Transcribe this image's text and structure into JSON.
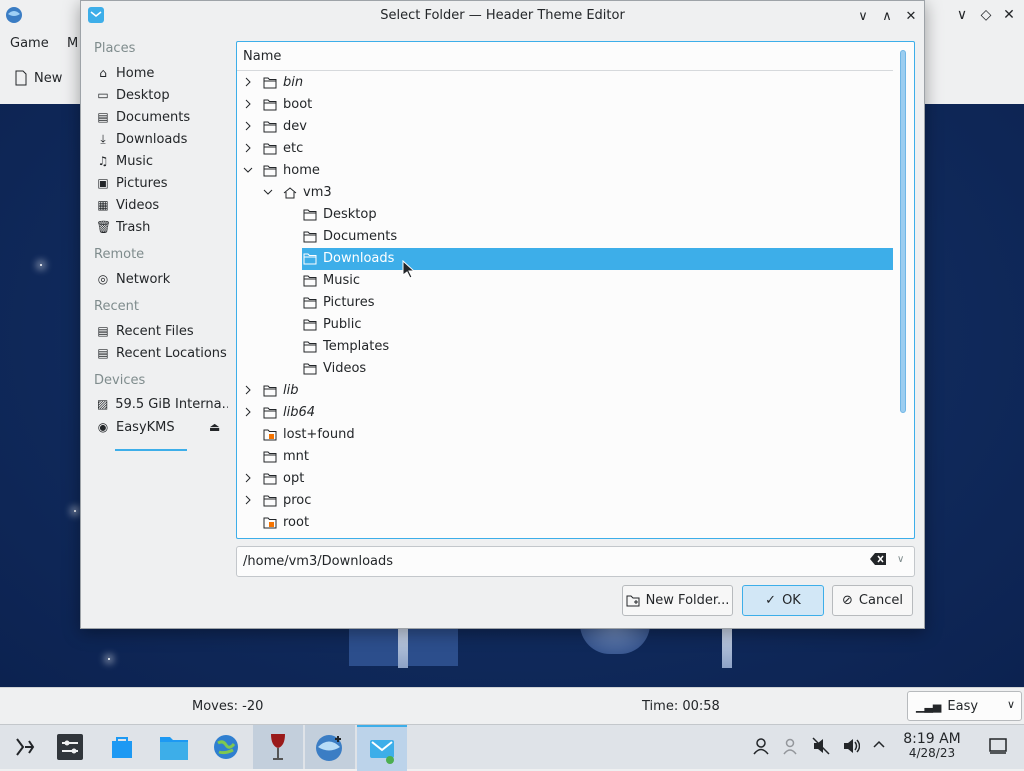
{
  "background_window": {
    "menu": [
      "Game",
      "M"
    ],
    "toolbar_new": "New",
    "status": {
      "moves": "Moves: -20",
      "time": "Time: 00:58",
      "difficulty": "Easy"
    }
  },
  "dialog": {
    "title": "Select Folder — Header Theme Editor",
    "places": {
      "sections": [
        {
          "heading": "Places",
          "items": [
            {
              "label": "Home",
              "icon": "home-icon"
            },
            {
              "label": "Desktop",
              "icon": "desktop-icon"
            },
            {
              "label": "Documents",
              "icon": "documents-icon"
            },
            {
              "label": "Downloads",
              "icon": "downloads-icon"
            },
            {
              "label": "Music",
              "icon": "music-icon"
            },
            {
              "label": "Pictures",
              "icon": "pictures-icon"
            },
            {
              "label": "Videos",
              "icon": "videos-icon"
            },
            {
              "label": "Trash",
              "icon": "trash-icon"
            }
          ]
        },
        {
          "heading": "Remote",
          "items": [
            {
              "label": "Network",
              "icon": "network-icon"
            }
          ]
        },
        {
          "heading": "Recent",
          "items": [
            {
              "label": "Recent Files",
              "icon": "recent-files-icon"
            },
            {
              "label": "Recent Locations",
              "icon": "recent-locations-icon"
            }
          ]
        },
        {
          "heading": "Devices",
          "items": [
            {
              "label": "59.5 GiB Interna…",
              "icon": "drive-icon"
            },
            {
              "label": "EasyKMS",
              "icon": "disc-icon"
            }
          ]
        }
      ]
    },
    "tree": {
      "column_header": "Name",
      "rows": [
        {
          "name": "bin",
          "depth": 0,
          "expander": "collapsed",
          "italic": true
        },
        {
          "name": "boot",
          "depth": 0,
          "expander": "collapsed",
          "italic": false
        },
        {
          "name": "dev",
          "depth": 0,
          "expander": "collapsed",
          "italic": false
        },
        {
          "name": "etc",
          "depth": 0,
          "expander": "collapsed",
          "italic": false
        },
        {
          "name": "home",
          "depth": 0,
          "expander": "expanded",
          "italic": false
        },
        {
          "name": "vm3",
          "depth": 1,
          "expander": "expanded",
          "italic": false,
          "icon": "home"
        },
        {
          "name": "Desktop",
          "depth": 2,
          "expander": "none",
          "italic": false
        },
        {
          "name": "Documents",
          "depth": 2,
          "expander": "none",
          "italic": false
        },
        {
          "name": "Downloads",
          "depth": 2,
          "expander": "none",
          "italic": false,
          "selected": true
        },
        {
          "name": "Music",
          "depth": 2,
          "expander": "none",
          "italic": false
        },
        {
          "name": "Pictures",
          "depth": 2,
          "expander": "none",
          "italic": false
        },
        {
          "name": "Public",
          "depth": 2,
          "expander": "none",
          "italic": false
        },
        {
          "name": "Templates",
          "depth": 2,
          "expander": "none",
          "italic": false
        },
        {
          "name": "Videos",
          "depth": 2,
          "expander": "none",
          "italic": false
        },
        {
          "name": "lib",
          "depth": 0,
          "expander": "collapsed",
          "italic": true
        },
        {
          "name": "lib64",
          "depth": 0,
          "expander": "collapsed",
          "italic": true
        },
        {
          "name": "lost+found",
          "depth": 0,
          "expander": "none",
          "italic": false,
          "locked": true
        },
        {
          "name": "mnt",
          "depth": 0,
          "expander": "none",
          "italic": false
        },
        {
          "name": "opt",
          "depth": 0,
          "expander": "collapsed",
          "italic": false
        },
        {
          "name": "proc",
          "depth": 0,
          "expander": "collapsed",
          "italic": false
        },
        {
          "name": "root",
          "depth": 0,
          "expander": "none",
          "italic": false,
          "locked": true
        }
      ]
    },
    "path": "/home/vm3/Downloads",
    "buttons": {
      "new_folder": "New Folder...",
      "ok": "OK",
      "cancel": "Cancel"
    }
  },
  "taskbar": {
    "clock_time": "8:19 AM",
    "clock_date": "4/28/23"
  },
  "colors": {
    "accent": "#3daee9",
    "window_bg": "#eff0f1",
    "board_bg": "#102a5c"
  }
}
